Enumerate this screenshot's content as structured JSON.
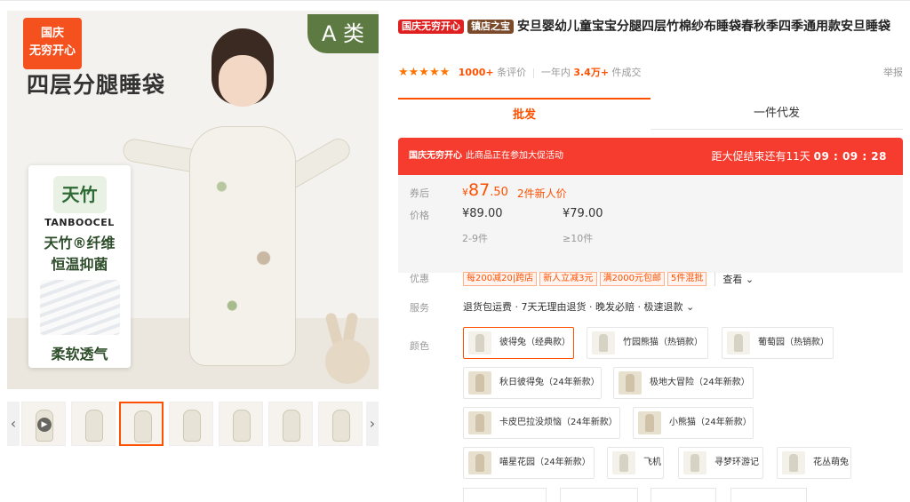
{
  "gallery": {
    "promo_tag_line1": "国庆",
    "promo_tag_line2": "无穷开心",
    "class_tag": "A 类",
    "headline": "四层分腿睡袋",
    "brand_logo": "天竹",
    "brand_name": "TANBOOCEL",
    "brand_line1": "天竹®纤维",
    "brand_line2": "恒温抑菌",
    "brand_line3": "柔软透气",
    "prev_icon": "chevron-left-icon",
    "next_icon": "chevron-right-icon",
    "play_icon": "play-icon"
  },
  "product": {
    "badge_festival": "国庆无穷开心",
    "badge_shop": "镇店之宝",
    "title": "安旦婴幼儿童宝宝分腿四层竹棉纱布睡袋春秋季四季通用款安旦睡袋",
    "stars": "★★★★★",
    "rating_score": 4.5,
    "reviews_count": "1000+",
    "reviews_label": "条评价",
    "year_label": "一年内",
    "sold_count": "3.4万+",
    "sold_label": "件成交",
    "report": "举报"
  },
  "tabs": {
    "wholesale": "批发",
    "dropship": "一件代发"
  },
  "promo_bar": {
    "name": "国庆无穷开心",
    "desc": "此商品正在参加大促活动",
    "countdown_prefix": "距大促结束还有",
    "days": "11天",
    "time": "09 : 09 : 28"
  },
  "price": {
    "coupon_label": "券后",
    "coupon_yen": "¥",
    "coupon_int": "87",
    "coupon_dec": ".50",
    "coupon_note": "2件新人价",
    "price_label": "价格",
    "tier1_price": "¥89.00",
    "tier2_price": "¥79.00",
    "tier1_qty": "2-9件",
    "tier2_qty": "≥10件"
  },
  "offers": {
    "label": "优惠",
    "coupons": [
      "每200减20|跨店",
      "新人立减3元",
      "满2000元包邮",
      "5件混批"
    ],
    "see_more": "查看"
  },
  "service": {
    "label": "服务",
    "text": "退货包运费 · 7天无理由退货 · 晚发必赔 · 极速退款"
  },
  "color": {
    "label": "颜色",
    "options": [
      "彼得兔（经典款）",
      "竹园熊猫（热销款）",
      "葡萄园（热销款）",
      "秋日彼得兔（24年新款）",
      "极地大冒险（24年新款）",
      "卡皮巴拉没烦恼（24年新款）",
      "小熊猫（24年新款）",
      "喵星花园（24年新款）",
      "飞机",
      "寻梦环游记",
      "花丛萌兔"
    ],
    "selected": "彼得兔（经典款）"
  },
  "colors": {
    "accent": "#ff5000",
    "promo_red": "#f53c2f",
    "badge_red": "#e02020",
    "badge_brown": "#7a4a2b",
    "class_tag_green": "#5d7a43",
    "star": "#ff7300"
  }
}
